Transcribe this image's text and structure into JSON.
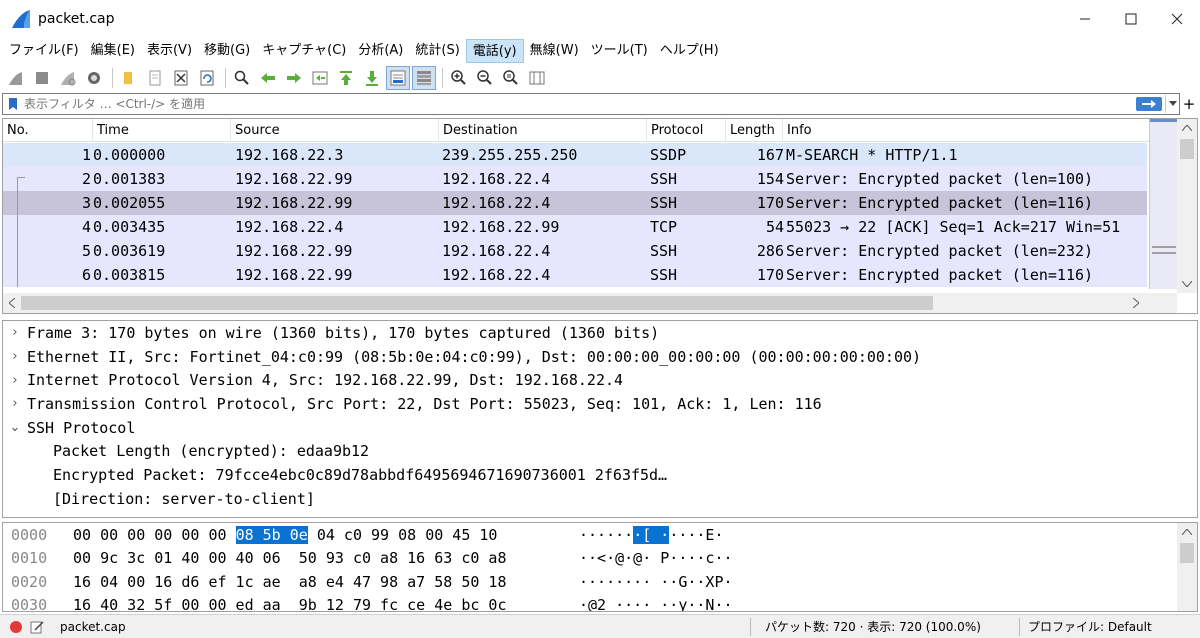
{
  "window": {
    "title": "packet.cap"
  },
  "menu": [
    {
      "label": "ファイル(F)"
    },
    {
      "label": "編集(E)"
    },
    {
      "label": "表示(V)"
    },
    {
      "label": "移動(G)"
    },
    {
      "label": "キャプチャ(C)"
    },
    {
      "label": "分析(A)"
    },
    {
      "label": "統計(S)"
    },
    {
      "label": "電話(y)"
    },
    {
      "label": "無線(W)"
    },
    {
      "label": "ツール(T)"
    },
    {
      "label": "ヘルプ(H)"
    }
  ],
  "filter": {
    "placeholder": "表示フィルタ … <Ctrl-/> を適用",
    "plus": "+"
  },
  "columns": {
    "no": "No.",
    "time": "Time",
    "source": "Source",
    "destination": "Destination",
    "protocol": "Protocol",
    "length": "Length",
    "info": "Info"
  },
  "packets": [
    {
      "no": "1",
      "time": "0.000000",
      "source": "192.168.22.3",
      "destination": "239.255.255.250",
      "protocol": "SSDP",
      "length": "167",
      "info": "M-SEARCH * HTTP/1.1"
    },
    {
      "no": "2",
      "time": "0.001383",
      "source": "192.168.22.99",
      "destination": "192.168.22.4",
      "protocol": "SSH",
      "length": "154",
      "info": "Server: Encrypted packet (len=100)"
    },
    {
      "no": "3",
      "time": "0.002055",
      "source": "192.168.22.99",
      "destination": "192.168.22.4",
      "protocol": "SSH",
      "length": "170",
      "info": "Server: Encrypted packet (len=116)"
    },
    {
      "no": "4",
      "time": "0.003435",
      "source": "192.168.22.4",
      "destination": "192.168.22.99",
      "protocol": "TCP",
      "length": "54",
      "info": "55023 → 22 [ACK] Seq=1 Ack=217 Win=51"
    },
    {
      "no": "5",
      "time": "0.003619",
      "source": "192.168.22.99",
      "destination": "192.168.22.4",
      "protocol": "SSH",
      "length": "286",
      "info": "Server: Encrypted packet (len=232)"
    },
    {
      "no": "6",
      "time": "0.003815",
      "source": "192.168.22.99",
      "destination": "192.168.22.4",
      "protocol": "SSH",
      "length": "170",
      "info": "Server: Encrypted packet (len=116)"
    }
  ],
  "details": [
    {
      "arrow": "›",
      "text": "Frame 3: 170 bytes on wire (1360 bits), 170 bytes captured (1360 bits)"
    },
    {
      "arrow": "›",
      "text": "Ethernet II, Src: Fortinet_04:c0:99 (08:5b:0e:04:c0:99), Dst: 00:00:00_00:00:00 (00:00:00:00:00:00)"
    },
    {
      "arrow": "›",
      "text": "Internet Protocol Version 4, Src: 192.168.22.99, Dst: 192.168.22.4"
    },
    {
      "arrow": "›",
      "text": "Transmission Control Protocol, Src Port: 22, Dst Port: 55023, Seq: 101, Ack: 1, Len: 116"
    },
    {
      "arrow": "⌄",
      "text": "SSH Protocol"
    },
    {
      "arrow": "",
      "text": "Packet Length (encrypted): edaa9b12"
    },
    {
      "arrow": "",
      "text": "Encrypted Packet: 79fcce4ebc0c89d78abbdf6495694671690736001 2f63f5d…"
    },
    {
      "arrow": "",
      "text": "[Direction: server-to-client]"
    }
  ],
  "bytes": [
    {
      "offset": "0000",
      "hex_pre": "00 00 00 00 00 00 ",
      "hex_hl": "08 5b 0e",
      "hex_post": " 04 c0 99 08 00 45 10",
      "ascii_pre": "······",
      "ascii_hl": "·[ ·",
      "ascii_post": "····E·"
    },
    {
      "offset": "0010",
      "hex_pre": "00 9c 3c 01 40 00 40 06  50 93 c0 a8 16 63 c0 a8",
      "hex_hl": "",
      "hex_post": "",
      "ascii_pre": "··<·@·@· P····c··",
      "ascii_hl": "",
      "ascii_post": ""
    },
    {
      "offset": "0020",
      "hex_pre": "16 04 00 16 d6 ef 1c ae  a8 e4 47 98 a7 58 50 18",
      "hex_hl": "",
      "hex_post": "",
      "ascii_pre": "········ ··G··XP·",
      "ascii_hl": "",
      "ascii_post": ""
    },
    {
      "offset": "0030",
      "hex_pre": "16 40 32 5f 00 00 ed aa  9b 12 79 fc ce 4e bc 0c",
      "hex_hl": "",
      "hex_post": "",
      "ascii_pre": "·@2_···· ··y··N··",
      "ascii_hl": "",
      "ascii_post": ""
    }
  ],
  "status": {
    "file": "packet.cap",
    "stats": "パケット数: 720 · 表示: 720 (100.0%)",
    "profile": "プロファイル: Default"
  },
  "colors": {
    "ssdp_row": "#dae7fb",
    "ssh_row": "#e7e6ff",
    "selected_row": "#c7c3d9",
    "byte_highlight": "#0a72d1"
  }
}
